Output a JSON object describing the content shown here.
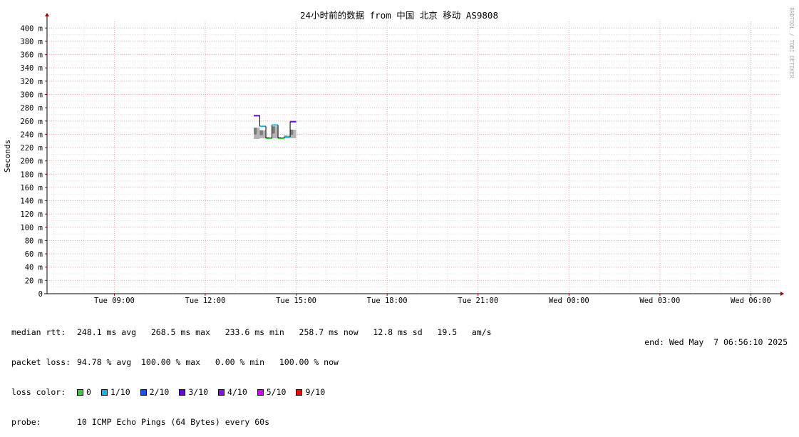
{
  "chart_data": {
    "type": "line",
    "title": "24小时前的数据 from 中国 北京 移动 AS9808",
    "ylabel": "Seconds",
    "watermark": "RRDTOOL / TOBI OETIKER",
    "ylim": [
      0,
      410
    ],
    "y_ticks": [
      "0",
      "20 m",
      "40 m",
      "60 m",
      "80 m",
      "100 m",
      "120 m",
      "140 m",
      "160 m",
      "180 m",
      "200 m",
      "220 m",
      "240 m",
      "260 m",
      "280 m",
      "300 m",
      "320 m",
      "340 m",
      "360 m",
      "380 m",
      "400 m"
    ],
    "x_ticks": [
      "Tue 09:00",
      "Tue 12:00",
      "Tue 15:00",
      "Tue 18:00",
      "Tue 21:00",
      "Wed 00:00",
      "Wed 03:00",
      "Wed 06:00"
    ],
    "x_range_hours": [
      6.78,
      30.93
    ],
    "grid": true,
    "series": [
      {
        "points": [
          {
            "t": 13.6,
            "median": 268,
            "min": 233,
            "max": 250,
            "color": "#6a00e6"
          },
          {
            "t": 13.8,
            "median": 252,
            "min": 234,
            "max": 246,
            "color": "#00b6ff"
          },
          {
            "t": 14.0,
            "median": 234,
            "min": 233,
            "max": 236,
            "color": "#22dd22"
          },
          {
            "t": 14.2,
            "median": 254,
            "min": 234,
            "max": 252,
            "color": "#00b6ff"
          },
          {
            "t": 14.4,
            "median": 234,
            "min": 233,
            "max": 236,
            "color": "#22dd22"
          },
          {
            "t": 14.6,
            "median": 236,
            "min": 234,
            "max": 238,
            "color": "#00b6ff"
          },
          {
            "t": 14.8,
            "median": 259,
            "min": 234,
            "max": 247,
            "color": "#6a00e6"
          }
        ]
      }
    ]
  },
  "legend": {
    "median_label": "median rtt:",
    "median_values": "248.1 ms avg   268.5 ms max   233.6 ms min   258.7 ms now   12.8 ms sd   19.5   am/s",
    "loss_label": "packet loss:",
    "loss_values": "94.78 % avg  100.00 % max   0.00 % min   100.00 % now",
    "color_label": "loss color:",
    "loss_colors": [
      {
        "label": "0",
        "color": "#22dd22"
      },
      {
        "label": "1/10",
        "color": "#00b6ff"
      },
      {
        "label": "2/10",
        "color": "#0f55ff"
      },
      {
        "label": "3/10",
        "color": "#6a00e6"
      },
      {
        "label": "4/10",
        "color": "#8a0cf0"
      },
      {
        "label": "5/10",
        "color": "#d400ff"
      },
      {
        "label": "9/10",
        "color": "#ff0000"
      }
    ],
    "probe_label": "probe:",
    "probe_value": "10 ICMP Echo Pings (64 Bytes) every 60s",
    "end_text": "end: Wed May  7 06:56:10 2025"
  }
}
